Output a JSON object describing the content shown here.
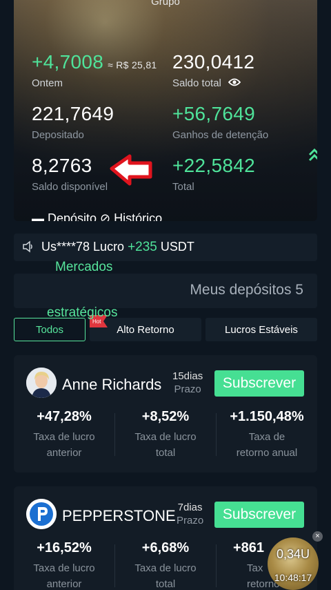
{
  "hero": {
    "title": "Grupo",
    "stats": {
      "yesterday": {
        "value": "+4,7008",
        "approx": "≈ R$ 25,81",
        "label": "Ontem"
      },
      "total_balance": {
        "value": "230,0412",
        "label": "Saldo total"
      },
      "deposited": {
        "value": "221,7649",
        "label": "Depositado"
      },
      "holding_gains": {
        "value": "+56,7649",
        "label": "Ganhos de detenção"
      },
      "available": {
        "value": "8,2763",
        "label": "Saldo disponível"
      },
      "total": {
        "value": "+22,5842",
        "label": "Total"
      }
    },
    "cut_row_text": "▬ Depósito       ⊘ Histórico",
    "icons": {
      "eye": "eye-icon",
      "up": "double-chevron-up-icon",
      "arrow": "red-pointer-arrow-icon"
    }
  },
  "ticker": {
    "user": "Us****78 Lucro ",
    "amount": "+235",
    "currency": " USDT",
    "icon": "speaker-icon"
  },
  "overlay": {
    "line1": "Mercados",
    "line2": "estratégicos"
  },
  "deposits": {
    "label": "Meus depósitos 5"
  },
  "tabs": [
    {
      "label": "Todos",
      "active": true
    },
    {
      "label": "Alto Retorno",
      "badge": "Hot"
    },
    {
      "label": "Lucros Estáveis"
    }
  ],
  "cards": [
    {
      "name": "Anne Richards",
      "days": "15dias",
      "period": "Prazo",
      "button": "Subscrever",
      "metrics": [
        {
          "value": "+47,28%",
          "label1": "Taxa de lucro",
          "label2": "anterior"
        },
        {
          "value": "+8,52%",
          "label1": "Taxa de lucro",
          "label2": "total"
        },
        {
          "value": "+1.150,48%",
          "label1": "Taxa de",
          "label2": "retorno anual"
        }
      ]
    },
    {
      "name": "PEPPERSTONE",
      "days": "7dias",
      "period": "Prazo",
      "button": "Subscrever",
      "metrics": [
        {
          "value": "+16,52%",
          "label1": "Taxa de lucro",
          "label2": "anterior"
        },
        {
          "value": "+6,68%",
          "label1": "Taxa de lucro",
          "label2": "total"
        },
        {
          "value": "+861",
          "label1": "Tax",
          "label2": "retorno a"
        }
      ]
    }
  ],
  "floating": {
    "value": "0,34U",
    "time": "10:48:17",
    "close": "×"
  },
  "colors": {
    "green": "#4fe39a",
    "button": "#46df93",
    "background": "#0d1620",
    "card": "#131c26"
  }
}
